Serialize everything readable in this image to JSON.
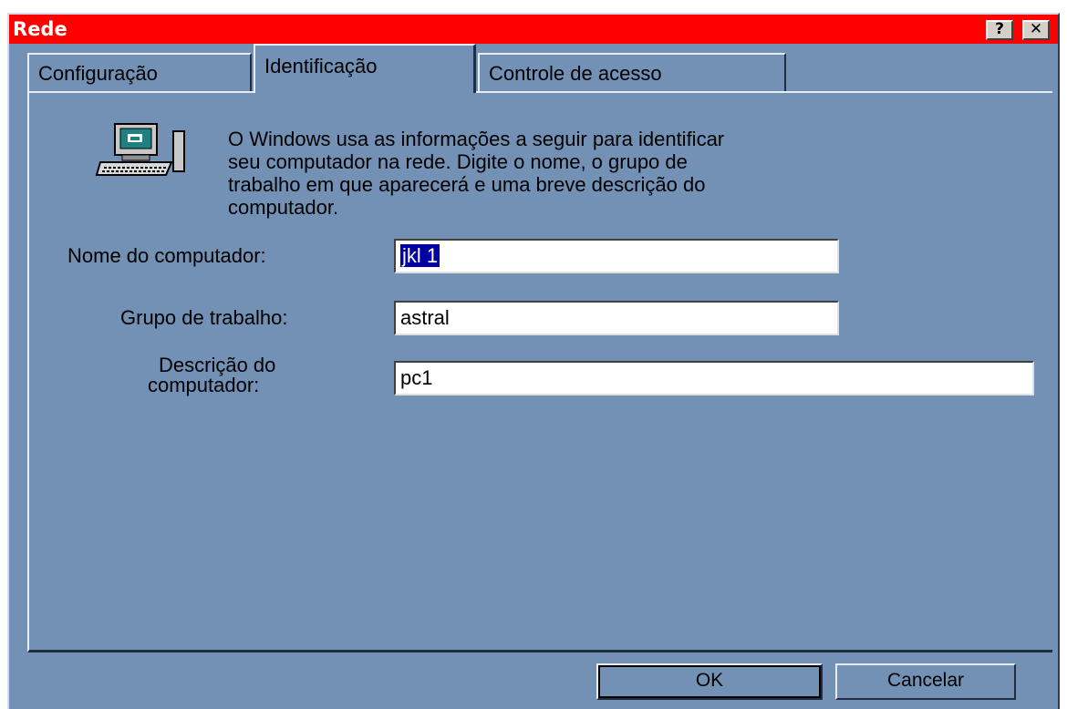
{
  "window": {
    "title": "Rede",
    "help_label": "?",
    "close_label": "✕"
  },
  "tabs": [
    {
      "label": "Configuração",
      "active": false
    },
    {
      "label": "Identificação",
      "active": true
    },
    {
      "label": "Controle de acesso",
      "active": false
    }
  ],
  "info": {
    "icon": "network-computer-icon",
    "lines": [
      "O Windows usa as informações a seguir para identificar",
      "seu computador na rede. Digite o nome, o grupo de",
      "trabalho em que aparecerá e uma breve descrição do",
      "computador."
    ]
  },
  "fields": {
    "computer_name": {
      "label": "Nome do computador:",
      "value": "jkl 1"
    },
    "workgroup": {
      "label": "Grupo de trabalho:",
      "value": "astral"
    },
    "description": {
      "label_line1": "Descrição do",
      "label_line2": "computador:",
      "value": "pc1"
    }
  },
  "buttons": {
    "ok": "OK",
    "cancel": "Cancelar"
  },
  "colors": {
    "titlebar": "#ff0000",
    "background": "#7391b5",
    "selection": "#0000a0"
  }
}
